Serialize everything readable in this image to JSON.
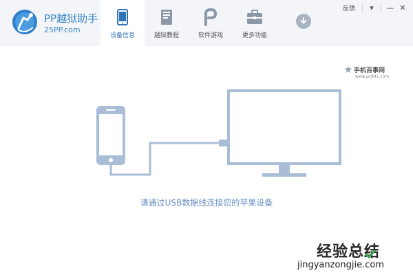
{
  "app": {
    "brand_title": "PP越狱助手",
    "brand_subtitle": "25PP.com"
  },
  "tabs": [
    {
      "label": "设备信息",
      "icon": "phone-icon",
      "active": true
    },
    {
      "label": "越狱教程",
      "icon": "book-icon",
      "active": false
    },
    {
      "label": "软件游戏",
      "icon": "pp-logo-icon",
      "active": false
    },
    {
      "label": "更多功能",
      "icon": "toolbox-icon",
      "active": false
    }
  ],
  "window": {
    "feedback_label": "反馈",
    "dropdown_icon": "▾",
    "minimize_icon": "—",
    "close_icon": "✕"
  },
  "main": {
    "instruction": "请通过USB数据线连接您的苹果设备"
  },
  "watermarks": {
    "top_text": "手机百事网",
    "top_url": "www.pc841.com",
    "bottom_cn": "经验总结",
    "bottom_url": "jingyanzongjie.com"
  },
  "colors": {
    "accent": "#3a86c8",
    "illustration": "#a9bdd6",
    "instruction": "#6b8fc2"
  }
}
